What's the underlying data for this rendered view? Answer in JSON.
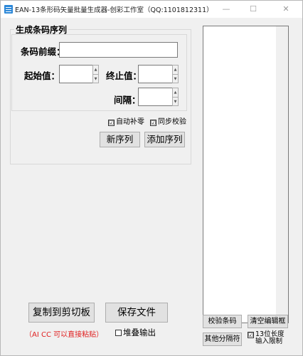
{
  "window": {
    "title": "EAN-13条形码矢量批量生成器-创彩工作室（QQ:1101812311）",
    "minimize_glyph": "—",
    "maximize_glyph": "☐",
    "close_glyph": "✕"
  },
  "group": {
    "title": "生成条码序列",
    "prefix_label": "条码前缀：",
    "prefix_value": "",
    "start_label": "起始值：",
    "start_value": "",
    "end_label": "终止值：",
    "end_value": "",
    "interval_label": "间隔：",
    "interval_value": "",
    "spin_up": "▲",
    "spin_down": "▼",
    "auto_pad_label": "自动补零",
    "auto_pad_checked": "☑",
    "sync_check_label": "同步校验",
    "sync_check_checked": "☑",
    "new_sequence_label": "新序列",
    "add_sequence_label": "添加序列"
  },
  "bottom": {
    "copy_label": "复制到剪切板",
    "save_label": "保存文件",
    "note": "（AI CC 可以直接粘贴）",
    "stack_output_label": "堆叠输出",
    "stack_output_checked": ""
  },
  "right": {
    "editor_text": "",
    "verify_label": "校验条码",
    "clear_label": "清空编辑框",
    "other_sep_label": "其他分隔符",
    "length13_label": "13位长度",
    "input_hint": "输入限制",
    "length13_checked": "☑"
  }
}
